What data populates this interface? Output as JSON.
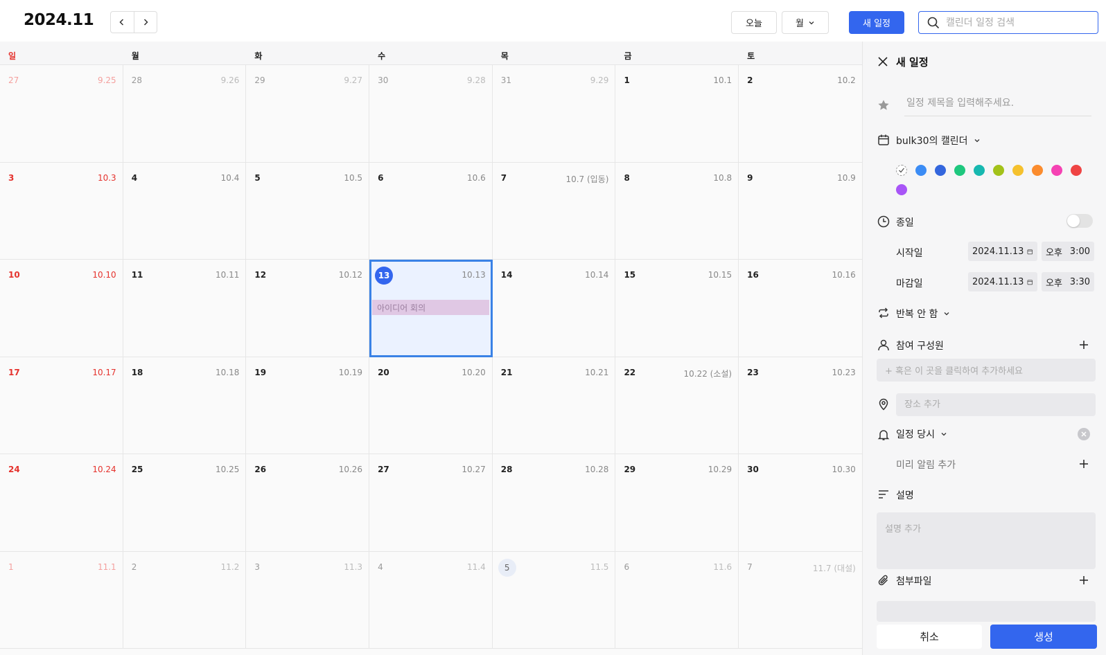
{
  "header": {
    "title": "2024.11",
    "today_label": "오늘",
    "view_label": "월",
    "new_event_label": "새 일정",
    "search_placeholder": "캘린더 일정 검색"
  },
  "weekdays": [
    "일",
    "월",
    "화",
    "수",
    "목",
    "금",
    "토"
  ],
  "weeks": [
    [
      {
        "day": "27",
        "lunar": "9.25",
        "dim": true
      },
      {
        "day": "28",
        "lunar": "9.26",
        "dim": true
      },
      {
        "day": "29",
        "lunar": "9.27",
        "dim": true
      },
      {
        "day": "30",
        "lunar": "9.28",
        "dim": true
      },
      {
        "day": "31",
        "lunar": "9.29",
        "dim": true
      },
      {
        "day": "1",
        "lunar": "10.1"
      },
      {
        "day": "2",
        "lunar": "10.2"
      }
    ],
    [
      {
        "day": "3",
        "lunar": "10.3"
      },
      {
        "day": "4",
        "lunar": "10.4"
      },
      {
        "day": "5",
        "lunar": "10.5"
      },
      {
        "day": "6",
        "lunar": "10.6"
      },
      {
        "day": "7",
        "lunar": "10.7 (입동)"
      },
      {
        "day": "8",
        "lunar": "10.8"
      },
      {
        "day": "9",
        "lunar": "10.9"
      }
    ],
    [
      {
        "day": "10",
        "lunar": "10.10"
      },
      {
        "day": "11",
        "lunar": "10.11"
      },
      {
        "day": "12",
        "lunar": "10.12"
      },
      {
        "day": "13",
        "lunar": "10.13",
        "selected": true,
        "event": "아이디어 회의"
      },
      {
        "day": "14",
        "lunar": "10.14"
      },
      {
        "day": "15",
        "lunar": "10.15"
      },
      {
        "day": "16",
        "lunar": "10.16"
      }
    ],
    [
      {
        "day": "17",
        "lunar": "10.17"
      },
      {
        "day": "18",
        "lunar": "10.18"
      },
      {
        "day": "19",
        "lunar": "10.19"
      },
      {
        "day": "20",
        "lunar": "10.20"
      },
      {
        "day": "21",
        "lunar": "10.21"
      },
      {
        "day": "22",
        "lunar": "10.22 (소설)"
      },
      {
        "day": "23",
        "lunar": "10.23"
      }
    ],
    [
      {
        "day": "24",
        "lunar": "10.24"
      },
      {
        "day": "25",
        "lunar": "10.25"
      },
      {
        "day": "26",
        "lunar": "10.26"
      },
      {
        "day": "27",
        "lunar": "10.27"
      },
      {
        "day": "28",
        "lunar": "10.28"
      },
      {
        "day": "29",
        "lunar": "10.29"
      },
      {
        "day": "30",
        "lunar": "10.30"
      }
    ],
    [
      {
        "day": "1",
        "lunar": "11.1",
        "dim": true
      },
      {
        "day": "2",
        "lunar": "11.2",
        "dim": true
      },
      {
        "day": "3",
        "lunar": "11.3",
        "dim": true
      },
      {
        "day": "4",
        "lunar": "11.4",
        "dim": true
      },
      {
        "day": "5",
        "lunar": "11.5",
        "dim": true,
        "today": true
      },
      {
        "day": "6",
        "lunar": "11.6",
        "dim": true
      },
      {
        "day": "7",
        "lunar": "11.7 (대설)",
        "dim": true
      }
    ]
  ],
  "panel": {
    "title": "새 일정",
    "title_placeholder": "일정 제목을 입력해주세요.",
    "calendar_name": "bulk30의 캘린더",
    "colors": [
      "#3b8cf5",
      "#3366dd",
      "#1ec77e",
      "#17b8b0",
      "#a3c21a",
      "#f5c12e",
      "#fb8c2e",
      "#f542b3",
      "#ef4444",
      "#a855f7"
    ],
    "all_day_label": "종일",
    "start_label": "시작일",
    "start_date": "2024.11.13",
    "start_ampm": "오후",
    "start_time": "3:00",
    "end_label": "마감일",
    "end_date": "2024.11.13",
    "end_ampm": "오후",
    "end_time": "3:30",
    "repeat_label": "반복 안 함",
    "members_label": "참여 구성원",
    "members_placeholder": "+ 혹은 이 곳을 클릭하여 추가하세요",
    "location_placeholder": "장소 추가",
    "alarm_label": "일정 당시",
    "pre_alarm_label": "미리 알림 추가",
    "description_label": "설명",
    "description_placeholder": "설명 추가",
    "attachment_label": "첨부파일",
    "cancel_label": "취소",
    "create_label": "생성"
  }
}
